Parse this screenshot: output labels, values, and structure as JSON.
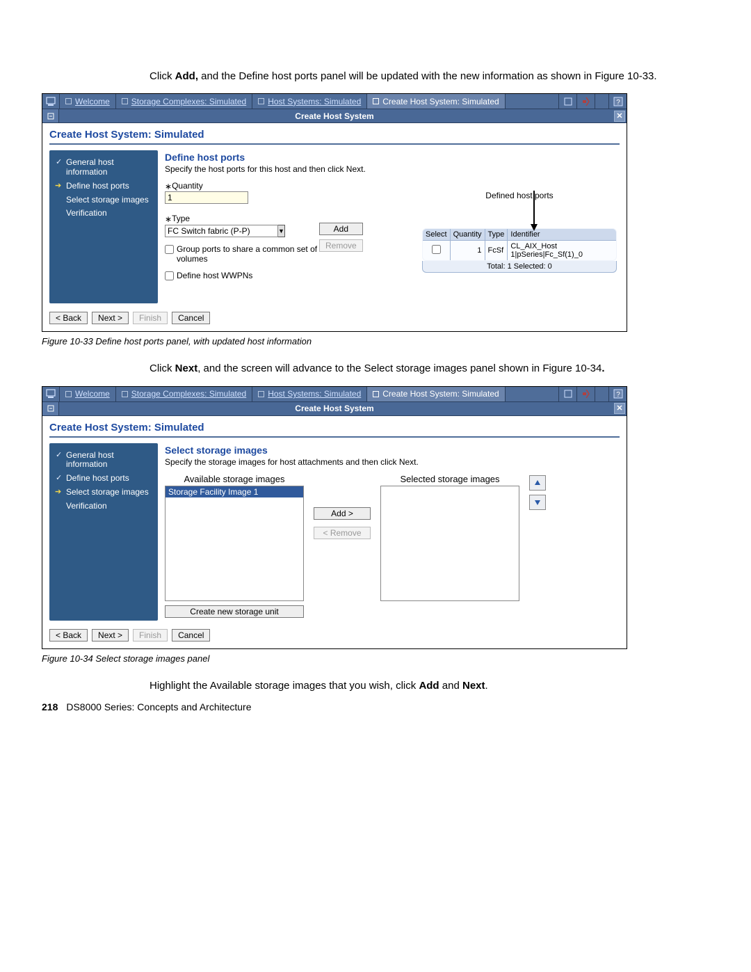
{
  "body": {
    "p1a": "Click ",
    "p1b": "Add,",
    "p1c": " and the Define host ports panel will be updated with the new information as shown in Figure 10-33.",
    "cap1": "Figure 10-33   Define host ports panel, with updated host information",
    "p2a": "Click ",
    "p2b": "Next",
    "p2c": ", and the screen will advance to the Select storage images panel shown in Figure 10-34",
    "p2d": ".",
    "cap2": "Figure 10-34   Select storage images panel",
    "p3a": "Highlight the Available storage images that you wish, click ",
    "p3b": "Add",
    "p3c": " and ",
    "p3d": "Next",
    "p3e": "."
  },
  "footer": {
    "page": "218",
    "title": "DS8000 Series: Concepts and Architecture"
  },
  "tabs": {
    "welcome": "Welcome",
    "storage": "Storage Complexes: Simulated",
    "hostsys": "Host Systems: Simulated",
    "create": "Create Host System: Simulated"
  },
  "titlebar": "Create Host System",
  "pagetitle": "Create Host System: Simulated",
  "wiz": {
    "s1": "General host information",
    "s2": "Define host ports",
    "s3": "Select storage images",
    "s4": "Verification"
  },
  "shot1": {
    "title": "Define host ports",
    "sub": "Specify the host ports for this host and then click Next.",
    "qtylabel": "Quantity",
    "qtyval": "1",
    "typelabel": "Type",
    "typeval": "FC Switch fabric (P-P)",
    "add": "Add",
    "remove": "Remove",
    "grp": "Group ports to share a common set of volumes",
    "wwpn": "Define host WWPNs",
    "defports": "Defined host ports",
    "th": {
      "sel": "Select",
      "qty": "Quantity",
      "type": "Type",
      "id": "Identifier"
    },
    "row": {
      "qty": "1",
      "type": "FcSf",
      "id": "CL_AIX_Host 1|pSeries|Fc_Sf(1)_0"
    },
    "foot": "Total: 1     Selected: 0"
  },
  "shot2": {
    "title": "Select storage images",
    "sub": "Specify the storage images for host attachments and then click Next.",
    "avail": "Available storage images",
    "sel": "Selected storage images",
    "item": "Storage Facility Image 1",
    "add": "Add >",
    "remove": "< Remove",
    "create": "Create new storage unit"
  },
  "btns": {
    "back": "< Back",
    "next": "Next >",
    "finish": "Finish",
    "cancel": "Cancel"
  }
}
